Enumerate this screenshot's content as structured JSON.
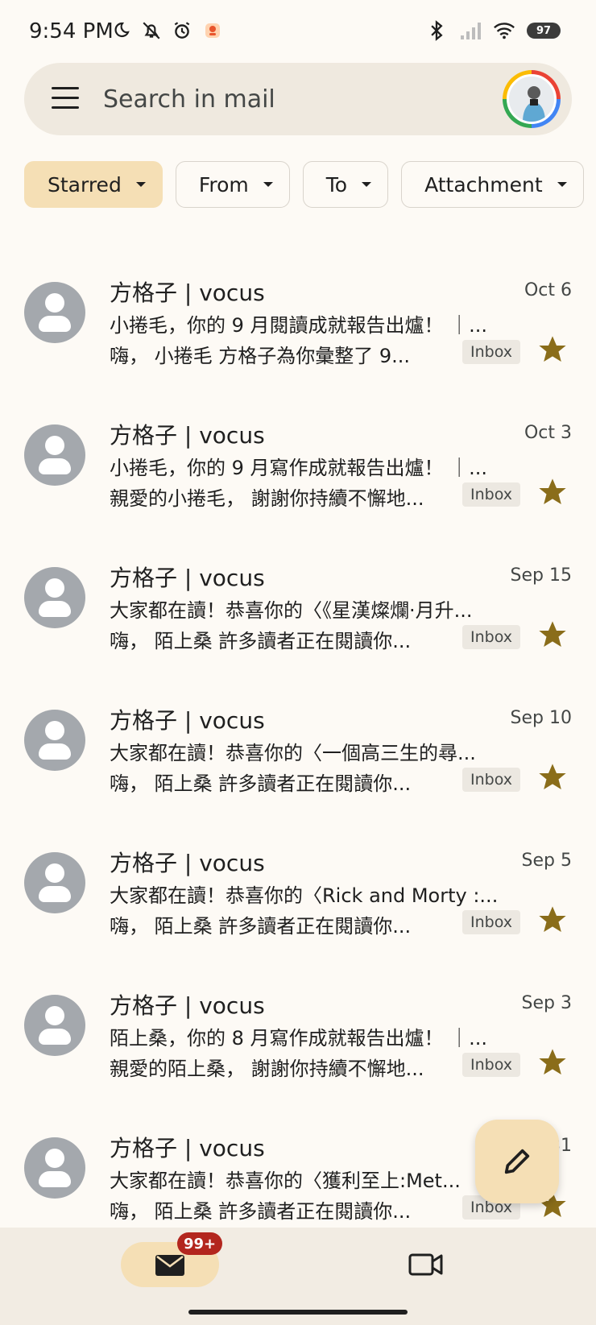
{
  "status_bar": {
    "time": "9:54 PM",
    "battery": "97",
    "icons_left": [
      "moon-icon",
      "bell-off-icon",
      "alarm-icon",
      "app-notification-icon"
    ],
    "icons_right": [
      "bluetooth-icon",
      "signal-icon",
      "wifi-icon",
      "battery-icon"
    ]
  },
  "search": {
    "placeholder": "Search in mail"
  },
  "filters": [
    {
      "label": "Starred",
      "active": true
    },
    {
      "label": "From",
      "active": false
    },
    {
      "label": "To",
      "active": false
    },
    {
      "label": "Attachment",
      "active": false
    }
  ],
  "emails": [
    {
      "sender": "方格子 | vocus",
      "date": "Oct 6",
      "subject": "小捲毛，你的 9 月閱讀成就報告出爐！ ｜...",
      "snippet": "嗨， 小捲毛 方格子為你彙整了 9...",
      "label": "Inbox",
      "starred": true
    },
    {
      "sender": "方格子 | vocus",
      "date": "Oct 3",
      "subject": "小捲毛，你的 9 月寫作成就報告出爐！ ｜...",
      "snippet": "親愛的小捲毛， 謝謝你持續不懈地...",
      "label": "Inbox",
      "starred": true
    },
    {
      "sender": "方格子 | vocus",
      "date": "Sep 15",
      "subject": "大家都在讀！恭喜你的〈《星漢燦爛·月升...",
      "snippet": "嗨， 陌上桑 許多讀者正在閱讀你...",
      "label": "Inbox",
      "starred": true
    },
    {
      "sender": "方格子 | vocus",
      "date": "Sep 10",
      "subject": "大家都在讀！恭喜你的〈一個高三生的尋...",
      "snippet": "嗨， 陌上桑 許多讀者正在閱讀你...",
      "label": "Inbox",
      "starred": true
    },
    {
      "sender": "方格子 | vocus",
      "date": "Sep 5",
      "subject": "大家都在讀！恭喜你的〈Rick and Morty :...",
      "snippet": "嗨， 陌上桑 許多讀者正在閱讀你...",
      "label": "Inbox",
      "starred": true
    },
    {
      "sender": "方格子 | vocus",
      "date": "Sep 3",
      "subject": "陌上桑，你的 8 月寫作成就報告出爐！ ｜...",
      "snippet": "親愛的陌上桑， 謝謝你持續不懈地...",
      "label": "Inbox",
      "starred": true
    },
    {
      "sender": "方格子 | vocus",
      "date": "Aug 31",
      "subject": "大家都在讀！恭喜你的〈獲利至上:Met...",
      "snippet": "嗨， 陌上桑 許多讀者正在閱讀你...",
      "label": "Inbox",
      "starred": true
    }
  ],
  "bottom_nav": {
    "mail_badge": "99+",
    "items": [
      "mail-icon",
      "video-icon"
    ]
  },
  "colors": {
    "background": "#fdfaf5",
    "accent": "#f5dfb5",
    "star": "#8a6d1a",
    "badge": "#b3261e"
  }
}
